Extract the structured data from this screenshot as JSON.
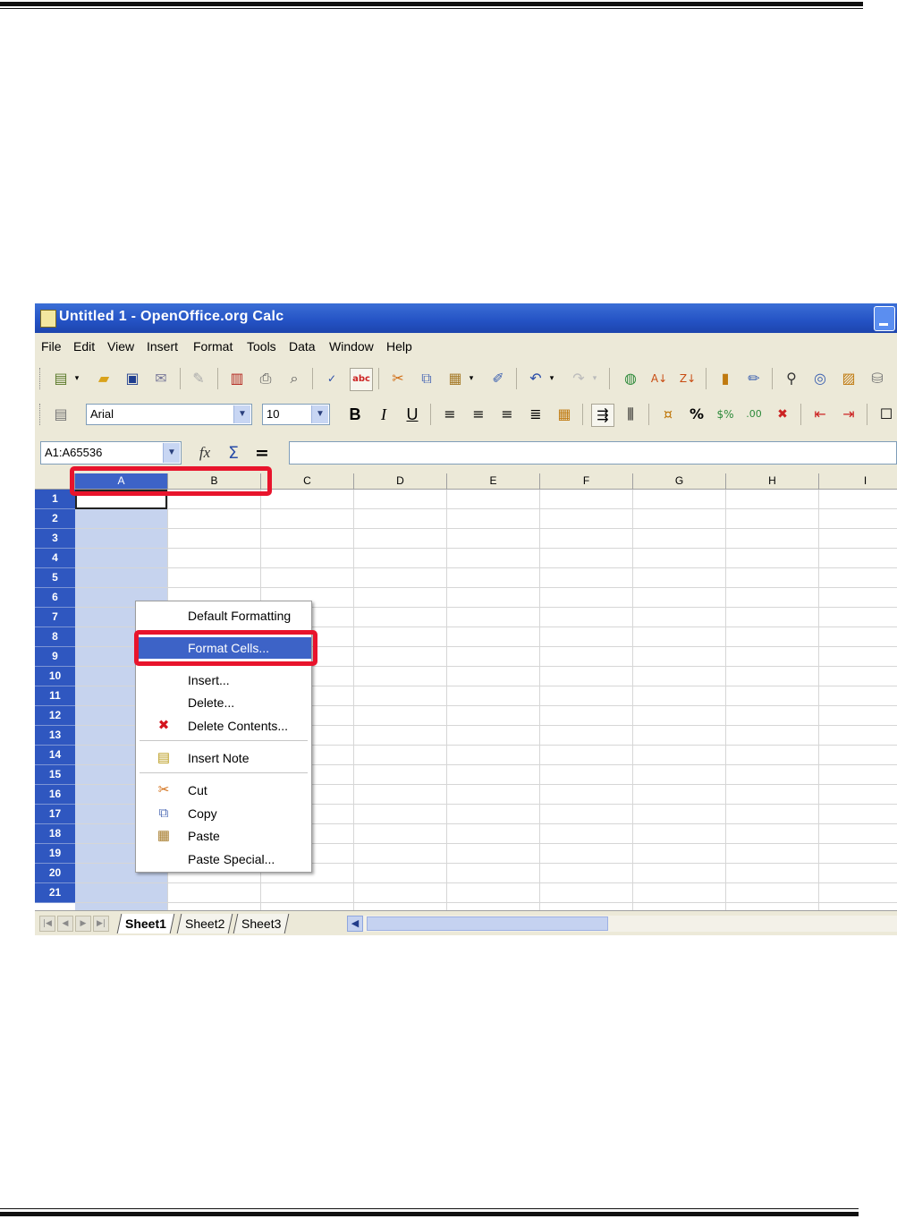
{
  "window": {
    "title": "Untitled 1 - OpenOffice.org Calc"
  },
  "menubar": [
    "File",
    "Edit",
    "View",
    "Insert",
    "Format",
    "Tools",
    "Data",
    "Window",
    "Help"
  ],
  "format_toolbar": {
    "font_name": "Arial",
    "font_size": "10",
    "bold": "B",
    "italic": "I",
    "underline": "U"
  },
  "formula_bar": {
    "name_box": "A1:A65536",
    "function_glyph": "fx",
    "sum_glyph": "Σ",
    "equals_glyph": "="
  },
  "columns": [
    "A",
    "B",
    "C",
    "D",
    "E",
    "F",
    "G",
    "H",
    "I"
  ],
  "rows": [
    "1",
    "2",
    "3",
    "4",
    "5",
    "6",
    "7",
    "8",
    "9",
    "10",
    "11",
    "12",
    "13",
    "14",
    "15",
    "16",
    "17",
    "18",
    "19",
    "20",
    "21"
  ],
  "context_menu": {
    "items": [
      "Default Formatting",
      "Format Cells...",
      "Insert...",
      "Delete...",
      "Delete Contents...",
      "Insert Note",
      "Cut",
      "Copy",
      "Paste",
      "Paste Special..."
    ],
    "highlighted": "Format Cells..."
  },
  "sheets": [
    "Sheet1",
    "Sheet2",
    "Sheet3"
  ],
  "colors": {
    "title_bar": "#2452c4",
    "selection": "#3d63c7",
    "highlight_annotation": "#e8142c"
  }
}
